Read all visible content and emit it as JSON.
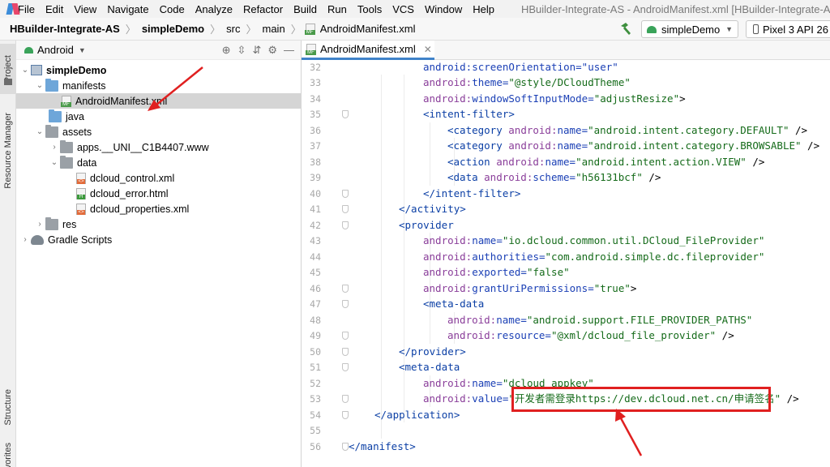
{
  "menubar": {
    "items": [
      "File",
      "Edit",
      "View",
      "Navigate",
      "Code",
      "Analyze",
      "Refactor",
      "Build",
      "Run",
      "Tools",
      "VCS",
      "Window",
      "Help"
    ],
    "window_title": "HBuilder-Integrate-AS - AndroidManifest.xml [HBuilder-Integrate-AS.simpleDemo]"
  },
  "navbar": {
    "project": "HBuilder-Integrate-AS",
    "module": "simpleDemo",
    "folder1": "src",
    "folder2": "main",
    "file": "AndroidManifest.xml",
    "run_config": "simpleDemo",
    "device": "Pixel 3 API 26"
  },
  "tool_stripe": {
    "project": "Project",
    "resource_manager": "Resource Manager",
    "structure": "Structure",
    "favorites": "Favorites"
  },
  "project_panel": {
    "view": "Android",
    "tree": [
      {
        "label": "simpleDemo",
        "icon": "module-icon",
        "expanded": true,
        "bold": true
      },
      {
        "label": "manifests",
        "icon": "folder-icon",
        "expanded": true
      },
      {
        "label": "AndroidManifest.xml",
        "icon": "manifest-file-icon",
        "selected": true
      },
      {
        "label": "java",
        "icon": "folder-icon",
        "expanded": false
      },
      {
        "label": "assets",
        "icon": "folder-icon",
        "expanded": true
      },
      {
        "label": "apps.__UNI__C1B4407.www",
        "icon": "folder-icon",
        "expanded": false
      },
      {
        "label": "data",
        "icon": "folder-icon",
        "expanded": true
      },
      {
        "label": "dcloud_control.xml",
        "icon": "xml-file-icon"
      },
      {
        "label": "dcloud_error.html",
        "icon": "html-file-icon"
      },
      {
        "label": "dcloud_properties.xml",
        "icon": "xml-file-icon"
      },
      {
        "label": "res",
        "icon": "folder-icon",
        "expanded": false
      },
      {
        "label": "Gradle Scripts",
        "icon": "gradle-icon",
        "expanded": false
      }
    ]
  },
  "editor": {
    "tab_label": "AndroidManifest.xml",
    "line_numbers": [
      "32",
      "33",
      "34",
      "35",
      "36",
      "37",
      "38",
      "39",
      "40",
      "41",
      "42",
      "43",
      "44",
      "45",
      "46",
      "47",
      "48",
      "49",
      "50",
      "51",
      "52",
      "53",
      "54",
      "55",
      "56"
    ],
    "lines": [
      [
        {
          "c": "an",
          "v": "android:screenOrientation=\"user\""
        }
      ],
      [
        {
          "c": "ns",
          "v": "android:"
        },
        {
          "c": "an",
          "v": "theme="
        },
        {
          "c": "av",
          "v": "\"@style/DCloudTheme\""
        }
      ],
      [
        {
          "c": "ns",
          "v": "android:"
        },
        {
          "c": "an",
          "v": "windowSoftInputMode="
        },
        {
          "c": "av",
          "v": "\"adjustResize\""
        },
        {
          "c": "p",
          "v": ">"
        }
      ],
      [
        {
          "c": "t",
          "v": "<intent-filter>"
        }
      ],
      [
        {
          "c": "t",
          "v": "<category "
        },
        {
          "c": "ns",
          "v": "android:"
        },
        {
          "c": "an",
          "v": "name="
        },
        {
          "c": "av",
          "v": "\"android.intent.category.DEFAULT\""
        },
        {
          "c": "p",
          "v": " />"
        }
      ],
      [
        {
          "c": "t",
          "v": "<category "
        },
        {
          "c": "ns",
          "v": "android:"
        },
        {
          "c": "an",
          "v": "name="
        },
        {
          "c": "av",
          "v": "\"android.intent.category.BROWSABLE\""
        },
        {
          "c": "p",
          "v": " />"
        }
      ],
      [
        {
          "c": "t",
          "v": "<action "
        },
        {
          "c": "ns",
          "v": "android:"
        },
        {
          "c": "an",
          "v": "name="
        },
        {
          "c": "av",
          "v": "\"android.intent.action.VIEW\""
        },
        {
          "c": "p",
          "v": " />"
        }
      ],
      [
        {
          "c": "t",
          "v": "<data "
        },
        {
          "c": "ns",
          "v": "android:"
        },
        {
          "c": "an",
          "v": "scheme="
        },
        {
          "c": "av",
          "v": "\"h56131bcf\""
        },
        {
          "c": "p",
          "v": " />"
        }
      ],
      [
        {
          "c": "t",
          "v": "</intent-filter>"
        }
      ],
      [
        {
          "c": "t",
          "v": "</activity>"
        }
      ],
      [
        {
          "c": "t",
          "v": "<provider"
        }
      ],
      [
        {
          "c": "ns",
          "v": "android:"
        },
        {
          "c": "an",
          "v": "name="
        },
        {
          "c": "av",
          "v": "\"io.dcloud.common.util.DCloud_FileProvider\""
        }
      ],
      [
        {
          "c": "ns",
          "v": "android:"
        },
        {
          "c": "an",
          "v": "authorities="
        },
        {
          "c": "av",
          "v": "\"com.android.simple.dc.fileprovider\""
        }
      ],
      [
        {
          "c": "ns",
          "v": "android:"
        },
        {
          "c": "an",
          "v": "exported="
        },
        {
          "c": "av",
          "v": "\"false\""
        }
      ],
      [
        {
          "c": "ns",
          "v": "android:"
        },
        {
          "c": "an",
          "v": "grantUriPermissions="
        },
        {
          "c": "av",
          "v": "\"true\""
        },
        {
          "c": "p",
          "v": ">"
        }
      ],
      [
        {
          "c": "t",
          "v": "<meta-data"
        }
      ],
      [
        {
          "c": "ns",
          "v": "android:"
        },
        {
          "c": "an",
          "v": "name="
        },
        {
          "c": "av",
          "v": "\"android.support.FILE_PROVIDER_PATHS\""
        }
      ],
      [
        {
          "c": "ns",
          "v": "android:"
        },
        {
          "c": "an",
          "v": "resource="
        },
        {
          "c": "av",
          "v": "\"@xml/dcloud_file_provider\""
        },
        {
          "c": "p",
          "v": " />"
        }
      ],
      [
        {
          "c": "t",
          "v": "</provider>"
        }
      ],
      [
        {
          "c": "t",
          "v": "<meta-data"
        }
      ],
      [
        {
          "c": "ns",
          "v": "android:"
        },
        {
          "c": "an",
          "v": "name="
        },
        {
          "c": "av",
          "v": "\"dcloud_appkey\""
        }
      ],
      [
        {
          "c": "ns",
          "v": "android:"
        },
        {
          "c": "an",
          "v": "value="
        },
        {
          "c": "av",
          "v": "\"开发者需登录https://dev.dcloud.net.cn/申请签名\""
        },
        {
          "c": "p",
          "v": " />"
        }
      ],
      [
        {
          "c": "t",
          "v": "</application>"
        }
      ],
      [],
      [
        {
          "c": "t",
          "v": "</manifest>"
        }
      ]
    ]
  },
  "colors": {
    "tag": "#0b3fa5",
    "attr_namespace": "#8a3e9a",
    "attr_name": "#1a3fb5",
    "attr_value": "#156b1a",
    "annotation": "#e02020",
    "tab_underline": "#4083c9"
  }
}
